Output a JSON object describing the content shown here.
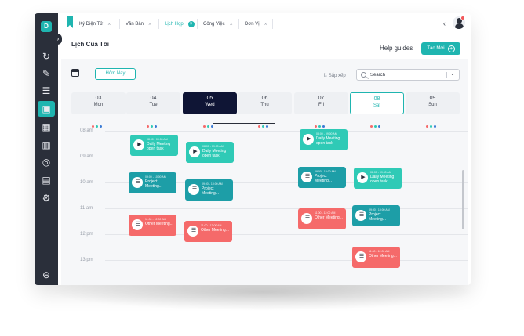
{
  "sidebar": {
    "logo": "D",
    "items": [
      {
        "icon": "refresh-icon",
        "glyph": "↻"
      },
      {
        "icon": "edit-icon",
        "glyph": "✎"
      },
      {
        "icon": "document-icon",
        "glyph": "☰"
      },
      {
        "icon": "calendar-icon",
        "glyph": "▣"
      },
      {
        "icon": "grid-icon",
        "glyph": "▦"
      },
      {
        "icon": "columns-icon",
        "glyph": "▥"
      },
      {
        "icon": "target-icon",
        "glyph": "◎"
      },
      {
        "icon": "briefcase-icon",
        "glyph": "▤"
      },
      {
        "icon": "settings-icon",
        "glyph": "⚙"
      }
    ],
    "logout_glyph": "⊖"
  },
  "tabs": [
    {
      "label": "Ký Điện Tử"
    },
    {
      "label": "Văn Bản"
    },
    {
      "label": "Lịch Họp"
    },
    {
      "label": "Công Việc"
    },
    {
      "label": "Đơn Vị"
    }
  ],
  "header": {
    "title": "Lịch Của Tôi",
    "help": "Help guides",
    "create": "Tạo Mới"
  },
  "toolbar": {
    "today": "Hôm Nay",
    "sort": "Sắp xếp",
    "search_placeholder": "Search"
  },
  "days": [
    {
      "num": "03",
      "name": "Mon"
    },
    {
      "num": "04",
      "name": "Tue"
    },
    {
      "num": "05",
      "name": "Wed"
    },
    {
      "num": "06",
      "name": "Thu"
    },
    {
      "num": "07",
      "name": "Fri"
    },
    {
      "num": "08",
      "name": "Sat"
    },
    {
      "num": "09",
      "name": "Sun"
    }
  ],
  "hours": [
    "08 am",
    "09 am",
    "10 am",
    "11 am",
    "12 pm",
    "13 pm"
  ],
  "events": [
    {
      "time": "08:00 - 09:00 AM",
      "title": "Daily Meeting open task",
      "color": "#2fcab6"
    },
    {
      "time": "08:00 - 09:00 AM",
      "title": "Daily Meeting open task",
      "color": "#2fcab6"
    },
    {
      "time": "08:00 - 09:00 AM",
      "title": "Daily Meeting open task",
      "color": "#2fcab6"
    },
    {
      "time": "09:00 - 10:00 AM",
      "title": "Project Meeting...",
      "color": "#1d9ea7"
    },
    {
      "time": "09:00 - 10:00 AM",
      "title": "Project Meeting...",
      "color": "#1d9ea7"
    },
    {
      "time": "09:00 - 10:00 AM",
      "title": "Project Meeting...",
      "color": "#1d9ea7"
    },
    {
      "time": "08:00 - 09:00 AM",
      "title": "Daily Meeting open task",
      "color": "#2fcab6"
    },
    {
      "time": "09:00 - 10:00 AM",
      "title": "Project Meeting...",
      "color": "#1d9ea7"
    },
    {
      "time": "11:00 - 12:00 AM",
      "title": "Other Meeting...",
      "color": "#f56a6a"
    },
    {
      "time": "11:00 - 12:00 AM",
      "title": "Other Meeting...",
      "color": "#f56a6a"
    },
    {
      "time": "11:00 - 12:00 AM",
      "title": "Other Meeting...",
      "color": "#f56a6a"
    },
    {
      "time": "11:00 - 12:00 AM",
      "title": "Other Meeting...",
      "color": "#f56a6a"
    }
  ],
  "dot_colors": [
    "#f56a6a",
    "#2fcab6",
    "#3a7bd5"
  ]
}
